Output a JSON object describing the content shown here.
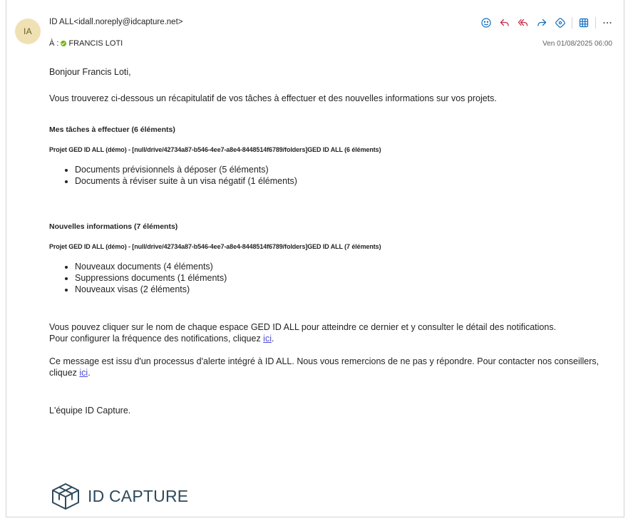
{
  "header": {
    "avatar_initials": "IA",
    "from": "ID ALL<idall.noreply@idcapture.net>",
    "to_prefix": "À :",
    "to_name": "FRANCIS LOTI",
    "date": "Ven 01/08/2025 06:00",
    "actions": [
      "smiley-icon",
      "reply-icon",
      "reply-all-icon",
      "forward-icon",
      "sticker-icon",
      "apps-icon",
      "more-icon"
    ]
  },
  "body": {
    "greeting": "Bonjour Francis Loti,",
    "intro": "Vous trouverez ci-dessous un récapitulatif de vos tâches à effectuer et des nouvelles informations sur vos projets.",
    "tasks": {
      "heading": "Mes tâches à effectuer (6 éléments)",
      "project": "Projet GED ID ALL (démo) - [null/drive/42734a87-b546-4ee7-a8e4-8448514f6789/folders]GED ID ALL (6 éléments)",
      "items": [
        "Documents prévisionnels à déposer (5 éléments)",
        "Documents à réviser suite à un visa négatif (1 éléments)"
      ]
    },
    "news": {
      "heading": "Nouvelles informations (7 éléments)",
      "project": "Projet GED ID ALL (démo) - [null/drive/42734a87-b546-4ee7-a8e4-8448514f6789/folders]GED ID ALL (7 éléments)",
      "items": [
        "Nouveaux documents (4 éléments)",
        "Suppressions documents (1 éléments)",
        "Nouveaux visas (2 éléments)"
      ]
    },
    "para1": "Vous pouvez cliquer sur le nom de chaque espace GED ID ALL pour atteindre ce dernier et y consulter le détail des notifications.",
    "para2_text": "Pour configurer la fréquence des notifications, cliquez ",
    "para2_link": "ici",
    "para2_end": ".",
    "para3_text": "Ce message est issu d'un processus d'alerte intégré à ID ALL. Nous vous remercions de ne pas y répondre. Pour contacter nos conseillers, cliquez ",
    "para3_link": "ici",
    "para3_end": ".",
    "signature": "L'équipe ID Capture.",
    "logo_text": "ID CAPTURE"
  },
  "colors": {
    "accent": "#0f6cbd",
    "avatar_bg": "#f0e1b4",
    "presence": "#6bb700",
    "link": "#4b4bd6",
    "logo": "#2f4a5c"
  }
}
